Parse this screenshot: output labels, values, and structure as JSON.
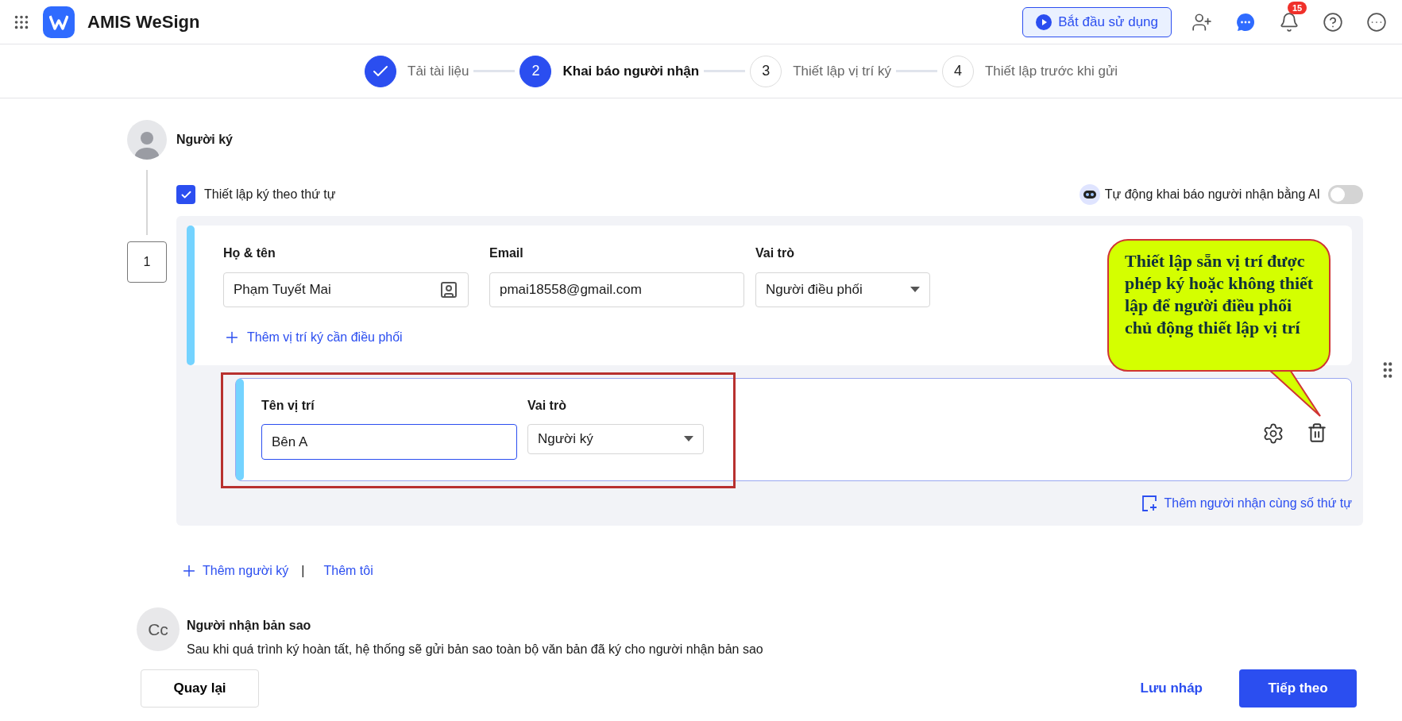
{
  "app": {
    "title": "AMIS WeSign"
  },
  "header": {
    "start_button": "Bắt đầu sử dụng",
    "notification_count": "15"
  },
  "steps": [
    {
      "done": true,
      "selected": false,
      "label": "Tải tài liệu"
    },
    {
      "done": false,
      "selected": true,
      "number": "2",
      "label": "Khai báo người nhận"
    },
    {
      "done": false,
      "selected": false,
      "number": "3",
      "label": "Thiết lập vị trí ký"
    },
    {
      "done": false,
      "selected": false,
      "number": "4",
      "label": "Thiết lập trước khi gửi"
    }
  ],
  "signers": {
    "title": "Người ký",
    "order_checkbox": {
      "label": "Thiết lập ký theo thứ tự",
      "checked": true
    },
    "ai_toggle": {
      "label": "Tự động khai báo người nhận bằng AI",
      "on": false
    },
    "groups": [
      {
        "order": "1",
        "recipient": {
          "name_label": "Họ & tên",
          "name": "Phạm Tuyết Mai",
          "email_label": "Email",
          "email": "pmai18558@gmail.com",
          "role_label": "Vai trò",
          "role": "Người điều phối",
          "add_position": "Thêm vị trí ký cần điều phối"
        },
        "positions": [
          {
            "name_label": "Tên vị trí",
            "name": "Bên A",
            "role_label": "Vai trò",
            "role": "Người ký",
            "highlighted": true
          }
        ],
        "add_same_order": "Thêm người nhận cùng số thứ tự"
      }
    ],
    "add_signer": "Thêm người ký",
    "separator": "|",
    "add_me": "Thêm tôi"
  },
  "callout": {
    "text": "Thiết lập sẵn vị trí được phép ký hoặc không thiết lập để người điều phối chủ động thiết lập vị trí"
  },
  "cc": {
    "avatar": "Cc",
    "title": "Người nhận bản sao",
    "description": "Sau khi quá trình ký hoàn tất, hệ thống sẽ gửi bản sao toàn bộ văn bản đã ký cho người nhận bản sao"
  },
  "footer": {
    "back": "Quay lại",
    "save_draft": "Lưu nháp",
    "next": "Tiếp theo"
  }
}
